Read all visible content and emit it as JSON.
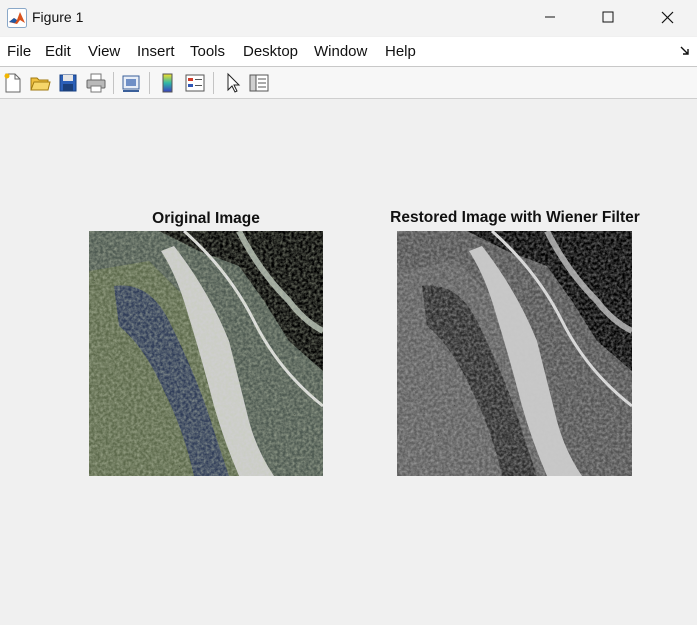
{
  "window": {
    "title": "Figure 1"
  },
  "menu": [
    "File",
    "Edit",
    "View",
    "Insert",
    "Tools",
    "Desktop",
    "Window",
    "Help"
  ],
  "toolbar": {
    "icons": [
      "new-figure-icon",
      "open-file-icon",
      "save-icon",
      "print-icon",
      "link-plot-icon",
      "colorbar-icon",
      "legend-icon",
      "pointer-icon",
      "property-inspector-icon"
    ]
  },
  "axes": [
    {
      "title": "Original Image",
      "style": "color satellite image with salt-and-pepper noise"
    },
    {
      "title": "Restored Image with Wiener Filter",
      "style": "grayscale satellite image with residual noise"
    }
  ],
  "colors": {
    "background": "#f0f0f0",
    "menubar": "#ffffff",
    "matlab_orange": "#d9531e",
    "matlab_blue": "#1f5aa6"
  }
}
